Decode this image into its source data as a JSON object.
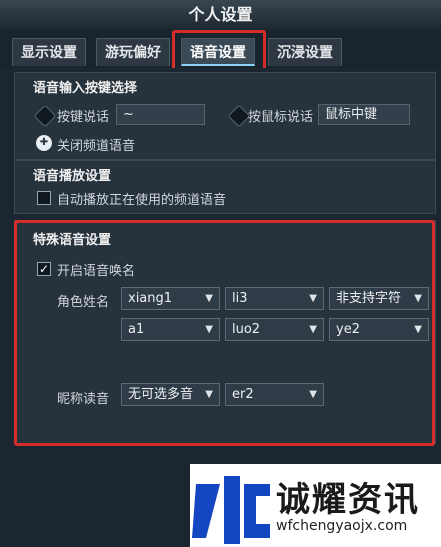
{
  "window": {
    "title": "个人设置"
  },
  "tabs": [
    {
      "label": "显示设置",
      "active": false
    },
    {
      "label": "游玩偏好",
      "active": false
    },
    {
      "label": "语音设置",
      "active": true
    },
    {
      "label": "沉浸设置",
      "active": false
    }
  ],
  "voice_input": {
    "title": "语音输入按键选择",
    "key_talk_label": "按键说话",
    "key_talk_value": "~",
    "mouse_talk_label": "按鼠标说话",
    "mouse_talk_value": "鼠标中键",
    "close_channel_label": "关闭频道语音"
  },
  "voice_playback": {
    "title": "语音播放设置",
    "autoplay_label": "自动播放正在使用的频道语音",
    "autoplay_checked": false
  },
  "special_voice": {
    "title": "特殊语音设置",
    "enable_label": "开启语音唤名",
    "enable_checked": true,
    "role_name_label": "角色姓名",
    "role_name_row1": [
      "xiang1",
      "li3",
      "非支持字符"
    ],
    "role_name_row2": [
      "a1",
      "luo2",
      "ye2"
    ],
    "nickname_label": "昵称读音",
    "nickname_row": [
      "无可选多音",
      "er2"
    ]
  },
  "watermark": {
    "brand": "诚耀资讯",
    "url": "wfchengyaojx.com"
  },
  "colors": {
    "highlight": "#d62c2c",
    "active_tab_underline": "#8fd3ff"
  }
}
